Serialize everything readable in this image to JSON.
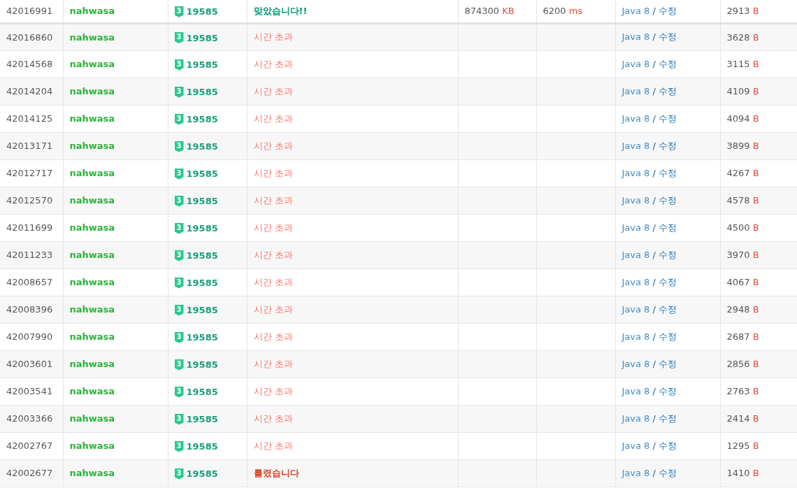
{
  "rows": [
    {
      "id": "42016991",
      "user": "nahwasa",
      "tier": "3",
      "problem": "19585",
      "result": {
        "kind": "ac",
        "text": "맞았습니다!!"
      },
      "memory": {
        "value": "874300",
        "unit": "KB"
      },
      "time": {
        "value": "6200",
        "unit": "ms"
      },
      "language": "Java 8",
      "separator": "/",
      "edit": "수정",
      "length": {
        "value": "2913",
        "unit": "B"
      }
    },
    {
      "id": "42016860",
      "user": "nahwasa",
      "tier": "3",
      "problem": "19585",
      "result": {
        "kind": "tle",
        "text": "시간 초과"
      },
      "language": "Java 8",
      "separator": "/",
      "edit": "수정",
      "length": {
        "value": "3628",
        "unit": "B"
      }
    },
    {
      "id": "42014568",
      "user": "nahwasa",
      "tier": "3",
      "problem": "19585",
      "result": {
        "kind": "tle",
        "text": "시간 초과"
      },
      "language": "Java 8",
      "separator": "/",
      "edit": "수정",
      "length": {
        "value": "3115",
        "unit": "B"
      }
    },
    {
      "id": "42014204",
      "user": "nahwasa",
      "tier": "3",
      "problem": "19585",
      "result": {
        "kind": "tle",
        "text": "시간 초과"
      },
      "language": "Java 8",
      "separator": "/",
      "edit": "수정",
      "length": {
        "value": "4109",
        "unit": "B"
      }
    },
    {
      "id": "42014125",
      "user": "nahwasa",
      "tier": "3",
      "problem": "19585",
      "result": {
        "kind": "tle",
        "text": "시간 초과"
      },
      "language": "Java 8",
      "separator": "/",
      "edit": "수정",
      "length": {
        "value": "4094",
        "unit": "B"
      }
    },
    {
      "id": "42013171",
      "user": "nahwasa",
      "tier": "3",
      "problem": "19585",
      "result": {
        "kind": "tle",
        "text": "시간 초과"
      },
      "language": "Java 8",
      "separator": "/",
      "edit": "수정",
      "length": {
        "value": "3899",
        "unit": "B"
      }
    },
    {
      "id": "42012717",
      "user": "nahwasa",
      "tier": "3",
      "problem": "19585",
      "result": {
        "kind": "tle",
        "text": "시간 초과"
      },
      "language": "Java 8",
      "separator": "/",
      "edit": "수정",
      "length": {
        "value": "4267",
        "unit": "B"
      }
    },
    {
      "id": "42012570",
      "user": "nahwasa",
      "tier": "3",
      "problem": "19585",
      "result": {
        "kind": "tle",
        "text": "시간 초과"
      },
      "language": "Java 8",
      "separator": "/",
      "edit": "수정",
      "length": {
        "value": "4578",
        "unit": "B"
      }
    },
    {
      "id": "42011699",
      "user": "nahwasa",
      "tier": "3",
      "problem": "19585",
      "result": {
        "kind": "tle",
        "text": "시간 초과"
      },
      "language": "Java 8",
      "separator": "/",
      "edit": "수정",
      "length": {
        "value": "4500",
        "unit": "B"
      }
    },
    {
      "id": "42011233",
      "user": "nahwasa",
      "tier": "3",
      "problem": "19585",
      "result": {
        "kind": "tle",
        "text": "시간 초과"
      },
      "language": "Java 8",
      "separator": "/",
      "edit": "수정",
      "length": {
        "value": "3970",
        "unit": "B"
      }
    },
    {
      "id": "42008657",
      "user": "nahwasa",
      "tier": "3",
      "problem": "19585",
      "result": {
        "kind": "tle",
        "text": "시간 초과"
      },
      "language": "Java 8",
      "separator": "/",
      "edit": "수정",
      "length": {
        "value": "4067",
        "unit": "B"
      }
    },
    {
      "id": "42008396",
      "user": "nahwasa",
      "tier": "3",
      "problem": "19585",
      "result": {
        "kind": "tle",
        "text": "시간 초과"
      },
      "language": "Java 8",
      "separator": "/",
      "edit": "수정",
      "length": {
        "value": "2948",
        "unit": "B"
      }
    },
    {
      "id": "42007990",
      "user": "nahwasa",
      "tier": "3",
      "problem": "19585",
      "result": {
        "kind": "tle",
        "text": "시간 초과"
      },
      "language": "Java 8",
      "separator": "/",
      "edit": "수정",
      "length": {
        "value": "2687",
        "unit": "B"
      }
    },
    {
      "id": "42003601",
      "user": "nahwasa",
      "tier": "3",
      "problem": "19585",
      "result": {
        "kind": "tle",
        "text": "시간 초과"
      },
      "language": "Java 8",
      "separator": "/",
      "edit": "수정",
      "length": {
        "value": "2856",
        "unit": "B"
      }
    },
    {
      "id": "42003541",
      "user": "nahwasa",
      "tier": "3",
      "problem": "19585",
      "result": {
        "kind": "tle",
        "text": "시간 초과"
      },
      "language": "Java 8",
      "separator": "/",
      "edit": "수정",
      "length": {
        "value": "2763",
        "unit": "B"
      }
    },
    {
      "id": "42003366",
      "user": "nahwasa",
      "tier": "3",
      "problem": "19585",
      "result": {
        "kind": "tle",
        "text": "시간 초과"
      },
      "language": "Java 8",
      "separator": "/",
      "edit": "수정",
      "length": {
        "value": "2414",
        "unit": "B"
      }
    },
    {
      "id": "42002767",
      "user": "nahwasa",
      "tier": "3",
      "problem": "19585",
      "result": {
        "kind": "tle",
        "text": "시간 초과"
      },
      "language": "Java 8",
      "separator": "/",
      "edit": "수정",
      "length": {
        "value": "1295",
        "unit": "B"
      }
    },
    {
      "id": "42002677",
      "user": "nahwasa",
      "tier": "3",
      "problem": "19585",
      "result": {
        "kind": "wa",
        "text": "틀렸습니다"
      },
      "language": "Java 8",
      "separator": "/",
      "edit": "수정",
      "length": {
        "value": "1410",
        "unit": "B"
      }
    }
  ]
}
